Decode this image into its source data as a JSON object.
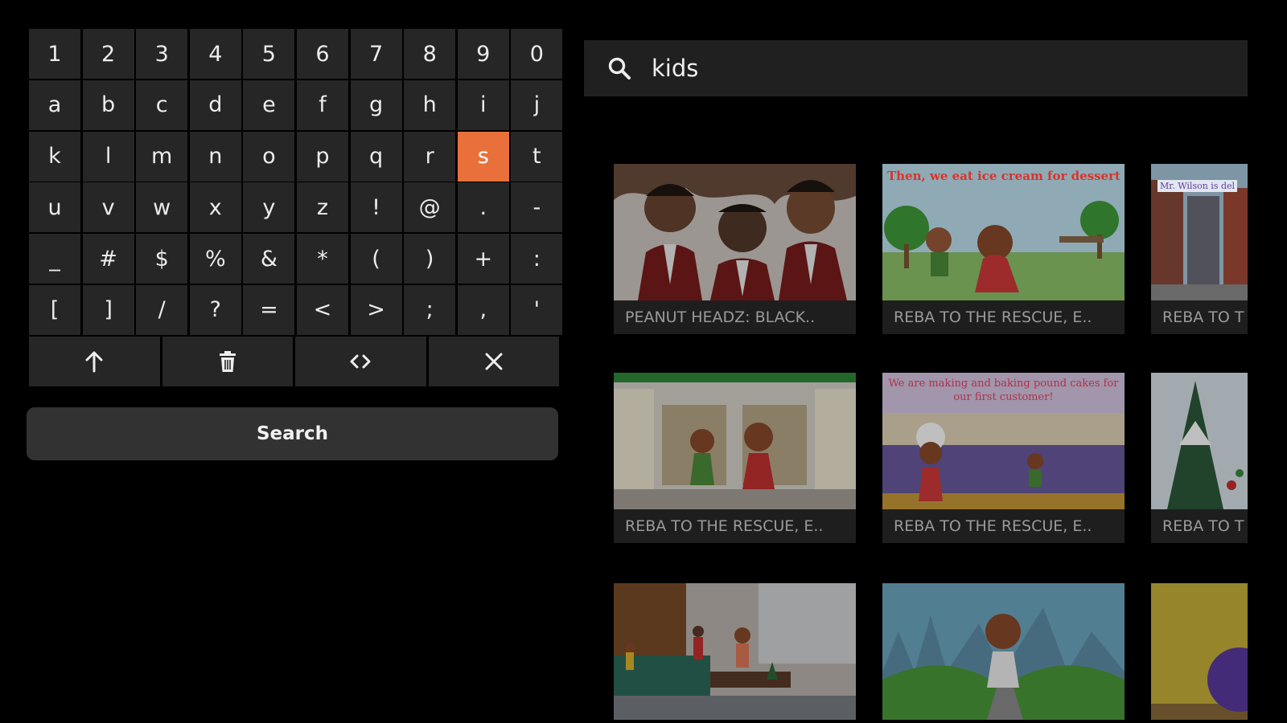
{
  "keyboard": {
    "rows": [
      [
        "1",
        "2",
        "3",
        "4",
        "5",
        "6",
        "7",
        "8",
        "9",
        "0"
      ],
      [
        "a",
        "b",
        "c",
        "d",
        "e",
        "f",
        "g",
        "h",
        "i",
        "j"
      ],
      [
        "k",
        "l",
        "m",
        "n",
        "o",
        "p",
        "q",
        "r",
        "s",
        "t"
      ],
      [
        "u",
        "v",
        "w",
        "x",
        "y",
        "z",
        "!",
        "@",
        ".",
        "-"
      ],
      [
        "_",
        "#",
        "$",
        "%",
        "&",
        "*",
        "(",
        ")",
        "+",
        ":"
      ],
      [
        "[",
        "]",
        "/",
        "?",
        "=",
        "<",
        ">",
        ";",
        ",",
        "'"
      ]
    ],
    "selected_key": "s",
    "actions": [
      {
        "name": "shift-key",
        "icon": "arrow-up-icon"
      },
      {
        "name": "delete-key",
        "icon": "trash-icon"
      },
      {
        "name": "cursor-key",
        "icon": "code-brackets-icon"
      },
      {
        "name": "clear-key",
        "icon": "close-icon"
      }
    ],
    "search_label": "Search"
  },
  "search": {
    "icon": "search-icon",
    "query": "kids"
  },
  "results": [
    {
      "title": "PEANUT HEADZ: BLACK..",
      "thumb_text": ""
    },
    {
      "title": "REBA TO THE RESCUE, E..",
      "thumb_text": "Then, we eat ice cream for dessert !"
    },
    {
      "title": "REBA TO T",
      "thumb_text": "Mr. Wilson is del"
    },
    {
      "title": "REBA TO THE RESCUE, E..",
      "thumb_text": ""
    },
    {
      "title": "REBA TO THE RESCUE, E..",
      "thumb_text": "We are making and baking pound cakes for our first customer!"
    },
    {
      "title": "REBA TO T",
      "thumb_text": ""
    },
    {
      "title": "",
      "thumb_text": ""
    },
    {
      "title": "",
      "thumb_text": ""
    },
    {
      "title": "",
      "thumb_text": ""
    }
  ],
  "colors": {
    "selected_key": "#e9703b",
    "key_bg": "#262626",
    "background": "#000000"
  }
}
